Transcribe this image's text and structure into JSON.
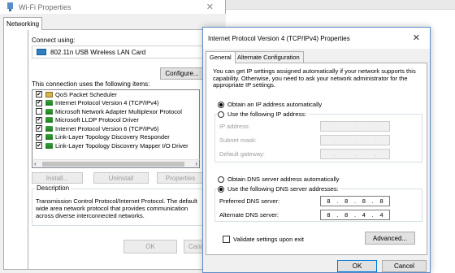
{
  "wifi": {
    "title": "Wi-Fi Properties",
    "close_glyph": "✕",
    "tab": "Networking",
    "connect_using_label": "Connect using:",
    "adapter_name": "802.11n USB Wireless LAN Card",
    "configure_label": "Configure...",
    "items_label": "This connection uses the following items:",
    "items": [
      {
        "label": "QoS Packet Scheduler",
        "checked": true,
        "icon": "service-icon"
      },
      {
        "label": "Internet Protocol Version 4 (TCP/IPv4)",
        "checked": true,
        "icon": "protocol-icon"
      },
      {
        "label": "Microsoft Network Adapter Multiplexor Protocol",
        "checked": false,
        "icon": "protocol-icon"
      },
      {
        "label": "Microsoft LLDP Protocol Driver",
        "checked": true,
        "icon": "protocol-icon"
      },
      {
        "label": "Internet Protocol Version 6 (TCP/IPv6)",
        "checked": true,
        "icon": "protocol-icon"
      },
      {
        "label": "Link-Layer Topology Discovery Responder",
        "checked": true,
        "icon": "protocol-icon"
      },
      {
        "label": "Link-Layer Topology Discovery Mapper I/O Driver",
        "checked": true,
        "icon": "protocol-icon"
      }
    ],
    "install_label": "Install...",
    "uninstall_label": "Uninstall",
    "properties_label": "Properties",
    "description_title": "Description",
    "description_text": "Transmission Control Protocol/Internet Protocol. The default wide area network protocol that provides communication across diverse interconnected networks.",
    "ok_label": "OK",
    "cancel_label": "Canc"
  },
  "dialog": {
    "title": "Internet Protocol Version 4 (TCP/IPv4) Properties",
    "close_glyph": "✕",
    "tabs": [
      "General",
      "Alternate Configuration"
    ],
    "intro": "You can get IP settings assigned automatically if your network supports this capability. Otherwise, you need to ask your network administrator for the appropriate IP settings.",
    "obtain_ip_auto": "Obtain an IP address automatically",
    "use_following_ip": "Use the following IP address:",
    "ip_address_label": "IP address:",
    "subnet_mask_label": "Subnet mask:",
    "default_gateway_label": "Default gateway:",
    "obtain_dns_auto": "Obtain DNS server address automatically",
    "use_following_dns": "Use the following DNS server addresses:",
    "preferred_dns_label": "Preferred DNS server:",
    "alternate_dns_label": "Alternate DNS server:",
    "preferred_dns": [
      "8",
      "8",
      "8",
      "8"
    ],
    "alternate_dns": [
      "8",
      "8",
      "4",
      "4"
    ],
    "dot": ".",
    "validate_label": "Validate settings upon exit",
    "advanced_label": "Advanced...",
    "ok_label": "OK",
    "cancel_label": "Cancel"
  },
  "colors": {
    "accent_border": "#5d8ec8",
    "ok_border": "#0078d7"
  }
}
